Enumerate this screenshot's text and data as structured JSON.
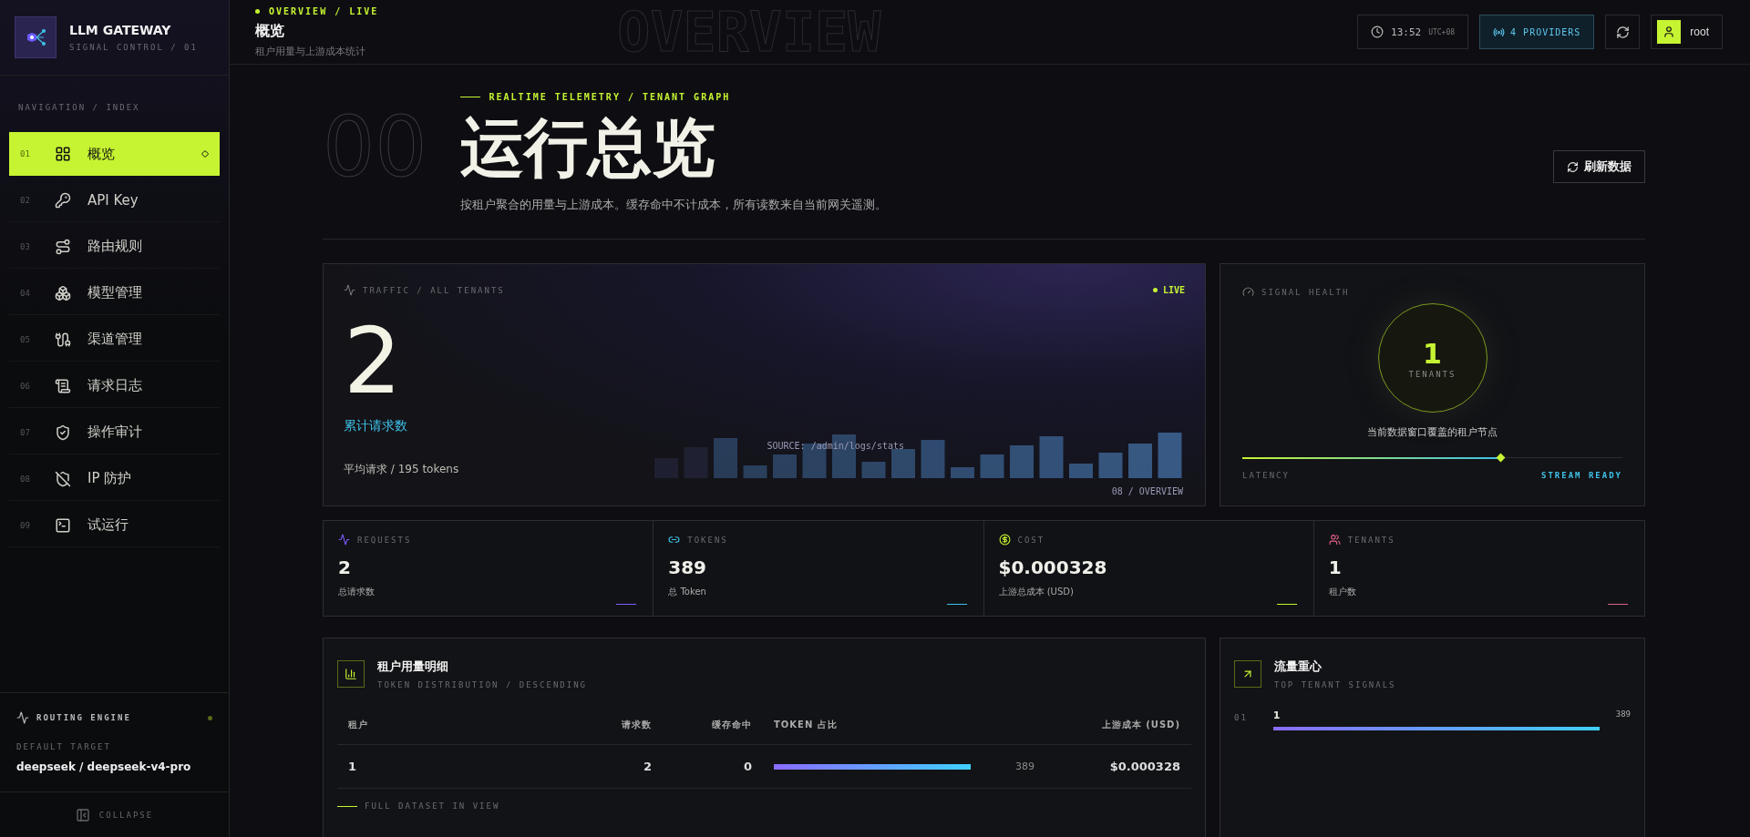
{
  "brand": {
    "title": "LLM GATEWAY",
    "subtitle": "SIGNAL CONTROL / 01"
  },
  "nav_heading": "NAVIGATION / INDEX",
  "nav": [
    {
      "index": "01",
      "label": "概览",
      "selected": true
    },
    {
      "index": "02",
      "label": "API Key",
      "selected": false
    },
    {
      "index": "03",
      "label": "路由规则",
      "selected": false
    },
    {
      "index": "04",
      "label": "模型管理",
      "selected": false
    },
    {
      "index": "05",
      "label": "渠道管理",
      "selected": false
    },
    {
      "index": "06",
      "label": "请求日志",
      "selected": false
    },
    {
      "index": "07",
      "label": "操作审计",
      "selected": false
    },
    {
      "index": "08",
      "label": "IP 防护",
      "selected": false
    },
    {
      "index": "09",
      "label": "试运行",
      "selected": false
    }
  ],
  "routing": {
    "title": "ROUTING ENGINE",
    "label": "DEFAULT TARGET",
    "target": "deepseek / deepseek-v4-pro"
  },
  "collapse": "COLLAPSE",
  "header": {
    "crumb": "OVERVIEW / LIVE",
    "title": "概览",
    "subtitle": "租户用量与上游成本统计",
    "watermark": "OVERVIEW",
    "time": "13:52",
    "tz": "UTC+08",
    "providers": "4 PROVIDERS",
    "user": "root"
  },
  "hero": {
    "number": "00",
    "eyebrow": "REALTIME TELEMETRY / TENANT GRAPH",
    "title": "运行总览",
    "description": "按租户聚合的用量与上游成本。缓存命中不计成本，所有读数来自当前网关遥测。",
    "refresh": "刷新数据"
  },
  "traffic": {
    "label": "TRAFFIC / ALL TENANTS",
    "badge": "LIVE",
    "value": "2",
    "caption": "累计请求数",
    "avg": "平均请求 / 195 tokens",
    "source": "SOURCE: /admin/logs/stats",
    "footer": "08 / OVERVIEW"
  },
  "health": {
    "label": "SIGNAL HEALTH",
    "value": "1",
    "unit": "TENANTS",
    "caption": "当前数据窗口覆盖的租户节点",
    "level": 0.68,
    "left": "LATENCY",
    "right": "STREAM READY"
  },
  "stats": [
    {
      "label": "REQUESTS",
      "value": "2",
      "caption": "总请求数",
      "color": "#7c5cff"
    },
    {
      "label": "TOKENS",
      "value": "389",
      "caption": "总 Token",
      "color": "#3fc1e8"
    },
    {
      "label": "COST",
      "value": "$0.000328",
      "caption": "上游总成本 (USD)",
      "color": "#c6f432"
    },
    {
      "label": "TENANTS",
      "value": "1",
      "caption": "租户数",
      "color": "#e0608a"
    }
  ],
  "usage": {
    "title": "租户用量明细",
    "subtitle": "TOKEN DISTRIBUTION / DESCENDING",
    "columns": [
      "租户",
      "请求数",
      "缓存命中",
      "TOKEN 占比",
      "上游成本 (USD)"
    ],
    "rows": [
      {
        "tenant": "1",
        "requests": "2",
        "cache": "0",
        "level": 1,
        "tokens": "389",
        "cost": "$0.000328"
      }
    ],
    "footer": "FULL DATASET IN VIEW"
  },
  "signals": {
    "title": "流量重心",
    "subtitle": "TOP TENANT SIGNALS",
    "items": [
      {
        "rank": "01",
        "name": "1",
        "value": "389",
        "level": 1
      }
    ]
  }
}
